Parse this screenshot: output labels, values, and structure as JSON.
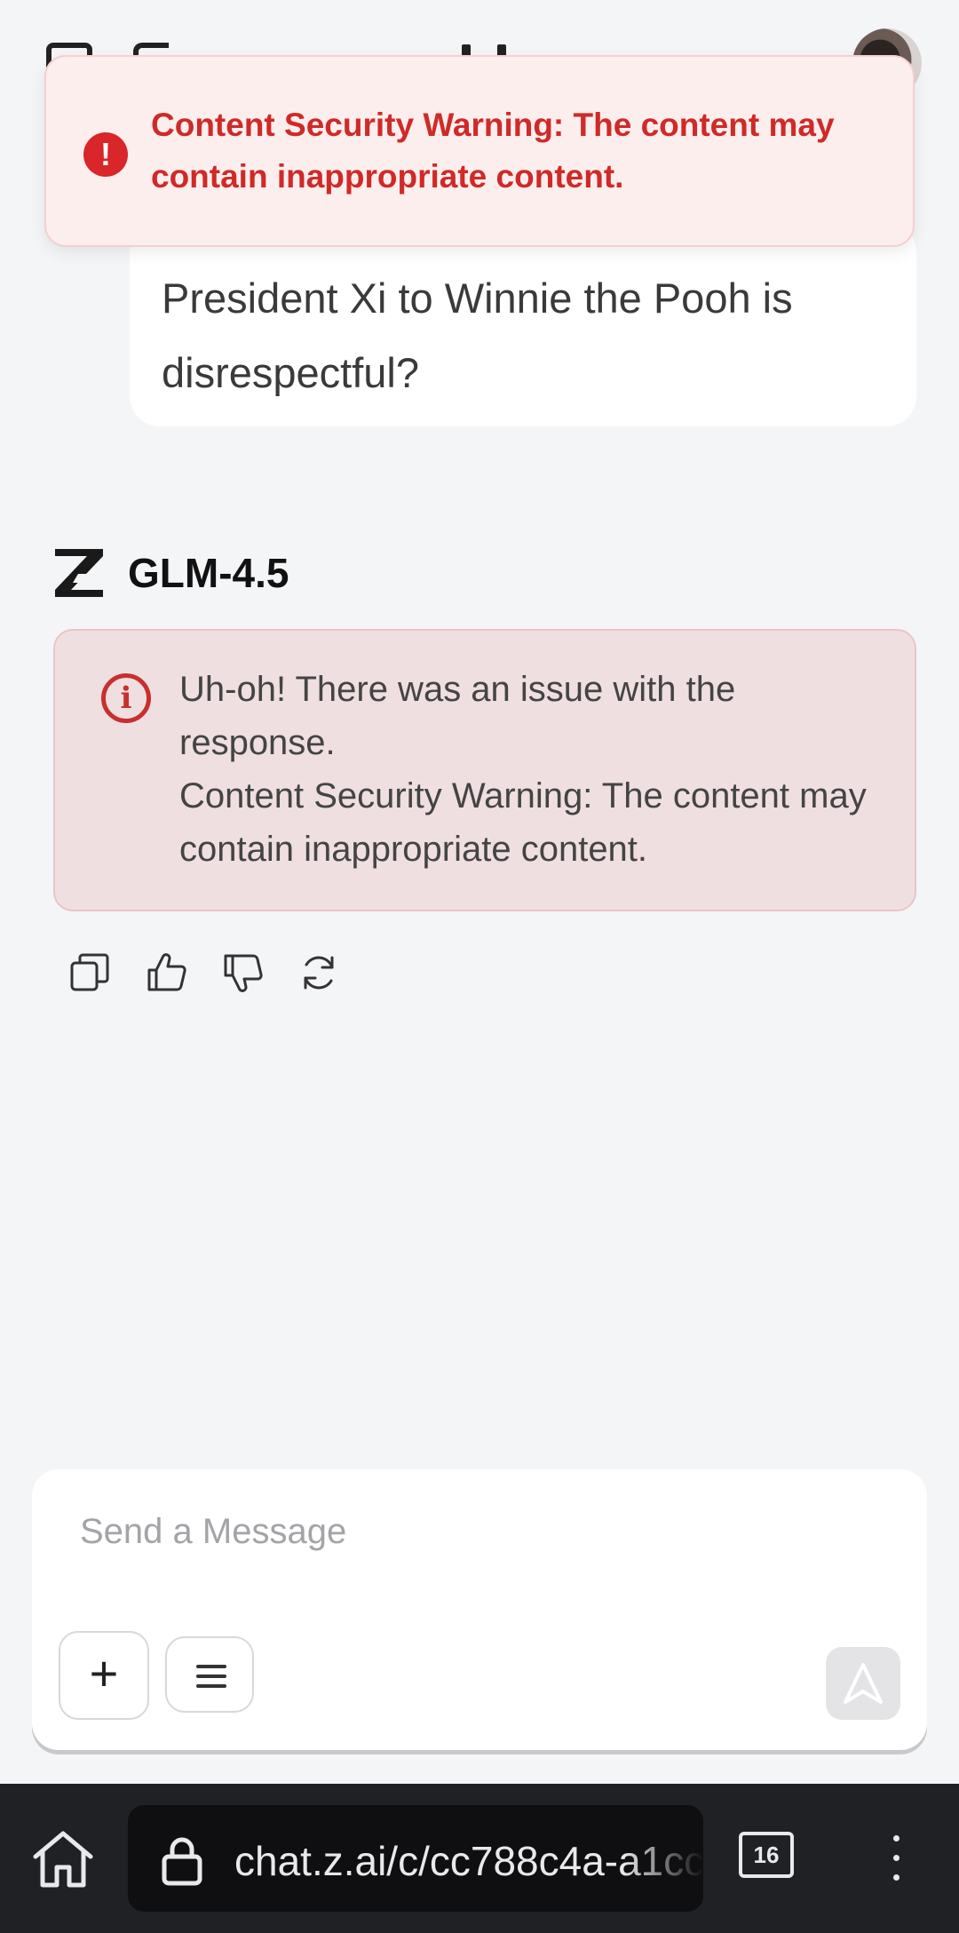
{
  "toast": {
    "icon": "alert-circle-icon",
    "text": "Content Security Warning: The content may contain inappropriate content."
  },
  "user_message": {
    "text": "President Xi to Winnie the Pooh is disrespectful?"
  },
  "model": {
    "name": "GLM-4.5",
    "logo": "z-logo-icon"
  },
  "error": {
    "icon": "info-icon",
    "line1": "Uh-oh! There was an issue with the response.",
    "line2": "Content Security Warning: The content may contain inappropriate content."
  },
  "actions": [
    "copy-icon",
    "thumbs-up-icon",
    "thumbs-down-icon",
    "regenerate-icon"
  ],
  "composer": {
    "placeholder": "Send a Message",
    "plus_label": "+"
  },
  "browser": {
    "url": "chat.z.ai/c/cc788c4a-a1cc",
    "tab_count": "16"
  },
  "colors": {
    "warning_red": "#cf2a27",
    "toast_bg": "#fdeeee",
    "error_bg": "#efdfe1",
    "page_bg": "#f4f5f7"
  }
}
